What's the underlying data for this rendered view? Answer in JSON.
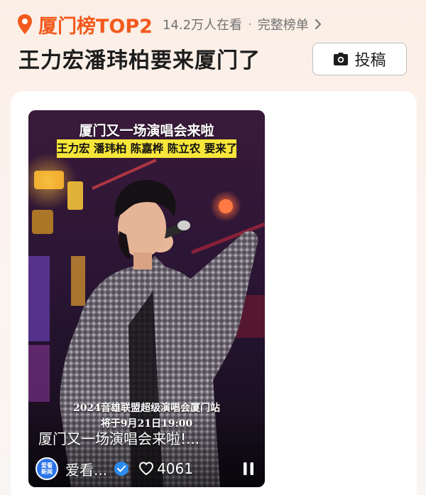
{
  "header": {
    "rank_title": "厦门榜TOP2",
    "viewers": "14.2万人在看",
    "separator": "·",
    "full_list_label": "完整榜单",
    "headline": "王力宏潘玮柏要来厦门了",
    "submit_label": "投稿"
  },
  "video": {
    "cover_title": "厦门又一场演唱会来啦",
    "cover_names": "王力宏 潘玮柏 陈嘉桦 陈立农 要来了",
    "cover_event": "2024音雄联盟超级演唱会厦门站",
    "cover_date": "将于9月21日19:00",
    "caption": "厦门又一场演唱会来啦!...",
    "author_logo": [
      "爱看",
      "新闻"
    ],
    "author_name": "爱看...",
    "likes": "4061"
  },
  "colors": {
    "accent": "#f25a1d",
    "names_banner": "#f7e63a",
    "verified": "#2c8cf0"
  },
  "icons": {
    "location": "location-pin-icon",
    "chevron": "chevron-right-icon",
    "camera": "camera-icon",
    "verified": "verified-check-icon",
    "heart": "heart-outline-icon",
    "pause": "pause-icon"
  }
}
